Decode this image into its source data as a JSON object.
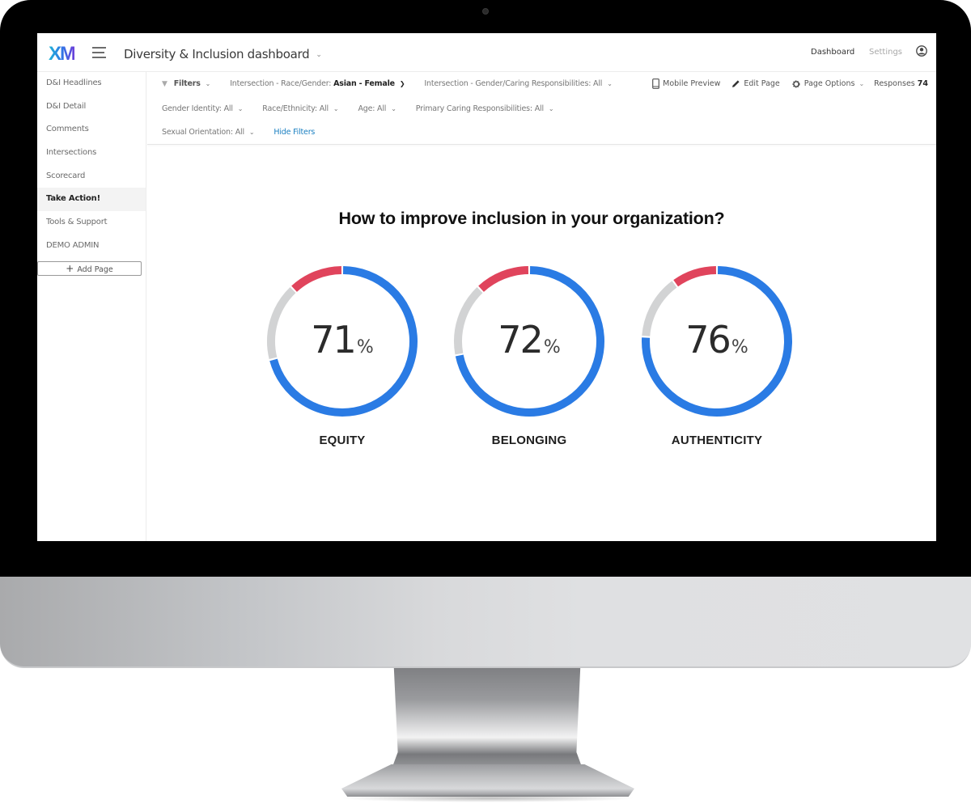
{
  "app": {
    "logo_text": "XM",
    "dashboard_title": "Diversity & Inclusion dashboard",
    "nav": {
      "dashboard": "Dashboard",
      "settings": "Settings"
    }
  },
  "sidebar": {
    "items": [
      {
        "label": "D&I Headlines",
        "active": false
      },
      {
        "label": "D&I Detail",
        "active": false
      },
      {
        "label": "Comments",
        "active": false
      },
      {
        "label": "Intersections",
        "active": false
      },
      {
        "label": "Scorecard",
        "active": false
      },
      {
        "label": "Take Action!",
        "active": true
      },
      {
        "label": "Tools & Support",
        "active": false
      },
      {
        "label": "DEMO ADMIN",
        "active": false
      }
    ],
    "add_page": "Add Page"
  },
  "filters": {
    "toggle_label": "Filters",
    "items": [
      {
        "label": "Intersection - Race/Gender:",
        "value": "Asian - Female",
        "highlight": true
      },
      {
        "label": "Intersection - Gender/Caring Responsibilities:",
        "value": "All"
      },
      {
        "label": "Gender Identity:",
        "value": "All"
      },
      {
        "label": "Race/Ethnicity:",
        "value": "All"
      },
      {
        "label": "Age:",
        "value": "All"
      },
      {
        "label": "Primary Caring Responsibilities:",
        "value": "All"
      },
      {
        "label": "Sexual Orientation:",
        "value": "All"
      }
    ],
    "hide_filters": "Hide Filters",
    "actions": {
      "mobile_preview": "Mobile Preview",
      "edit_page": "Edit Page",
      "page_options": "Page Options",
      "responses_label": "Responses",
      "responses_count": "74"
    }
  },
  "main": {
    "headline": "How to improve inclusion in your organization?"
  },
  "colors": {
    "favorable": "#2a7be4",
    "neutral": "#d2d3d4",
    "unfavorable": "#e0445c"
  },
  "chart_data": {
    "type": "pie",
    "title": "How to improve inclusion in your organization?",
    "variant": "donut",
    "charts": [
      {
        "label": "EQUITY",
        "display_value": "71",
        "unit": "%",
        "segments": [
          {
            "name": "favorable",
            "value": 71
          },
          {
            "name": "neutral",
            "value": 17
          },
          {
            "name": "unfavorable",
            "value": 12
          }
        ]
      },
      {
        "label": "BELONGING",
        "display_value": "72",
        "unit": "%",
        "segments": [
          {
            "name": "favorable",
            "value": 72
          },
          {
            "name": "neutral",
            "value": 16
          },
          {
            "name": "unfavorable",
            "value": 12
          }
        ]
      },
      {
        "label": "AUTHENTICITY",
        "display_value": "76",
        "unit": "%",
        "segments": [
          {
            "name": "favorable",
            "value": 76
          },
          {
            "name": "neutral",
            "value": 14
          },
          {
            "name": "unfavorable",
            "value": 10
          }
        ]
      }
    ]
  }
}
